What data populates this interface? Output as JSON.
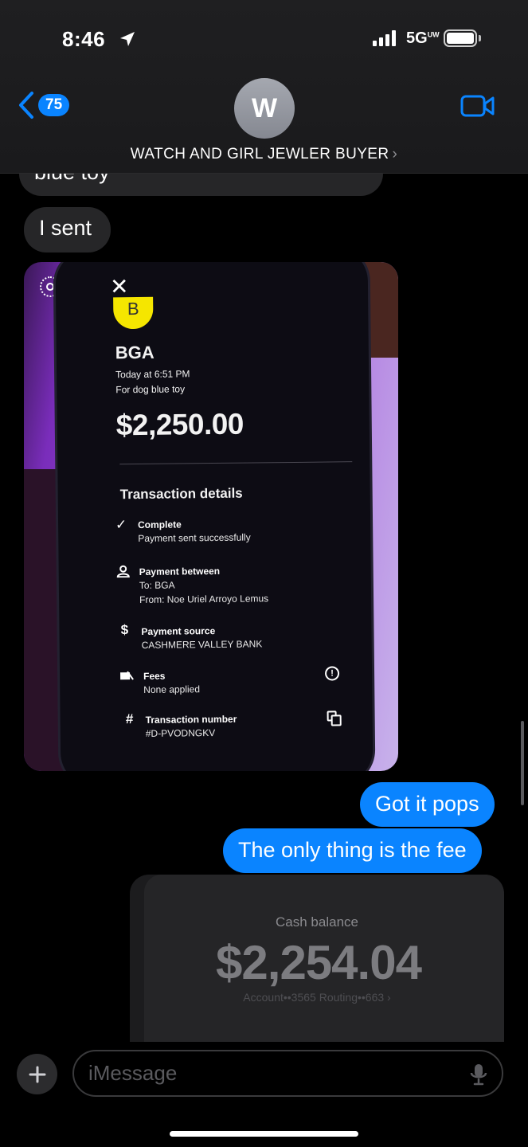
{
  "status_bar": {
    "time": "8:46",
    "network": "5G",
    "network_sup": "UW"
  },
  "header": {
    "back_count": "75",
    "avatar_initial": "W",
    "contact_name": "WATCH AND GIRL JEWLER BUYER",
    "name_chevron": "›"
  },
  "messages": {
    "in_partial": "blue toy",
    "in_sent": "I sent",
    "out_1": "Got it pops",
    "out_2": "The only thing is the fee"
  },
  "payment_screenshot": {
    "close": "✕",
    "merchant_initial": "B",
    "merchant": "BGA",
    "date": "Today at 6:51 PM",
    "note": "For dog blue toy",
    "amount": "$2,250.00",
    "details_title": "Transaction details",
    "rows": [
      {
        "icon": "✓",
        "title": "Complete",
        "lines": [
          "Payment sent successfully"
        ]
      },
      {
        "icon": "person",
        "title": "Payment between",
        "lines": [
          "To: BGA",
          "From: Noe Uriel Arroyo Lemus"
        ]
      },
      {
        "icon": "$",
        "title": "Payment source",
        "lines": [
          "CASHMERE VALLEY BANK"
        ]
      },
      {
        "icon": "fees",
        "title": "Fees",
        "lines": [
          "None applied"
        ]
      },
      {
        "icon": "#",
        "title": "Transaction number",
        "lines": [
          "#D-PVODNGKV"
        ]
      }
    ],
    "info_icon": "!"
  },
  "cash_card": {
    "label": "Cash balance",
    "amount": "$2,254.04",
    "account": "Account••3565   Routing••663  ›"
  },
  "input": {
    "placeholder": "iMessage",
    "plus": "+"
  },
  "colors": {
    "accent": "#0a84ff",
    "incoming": "#262628",
    "background": "#000000"
  }
}
